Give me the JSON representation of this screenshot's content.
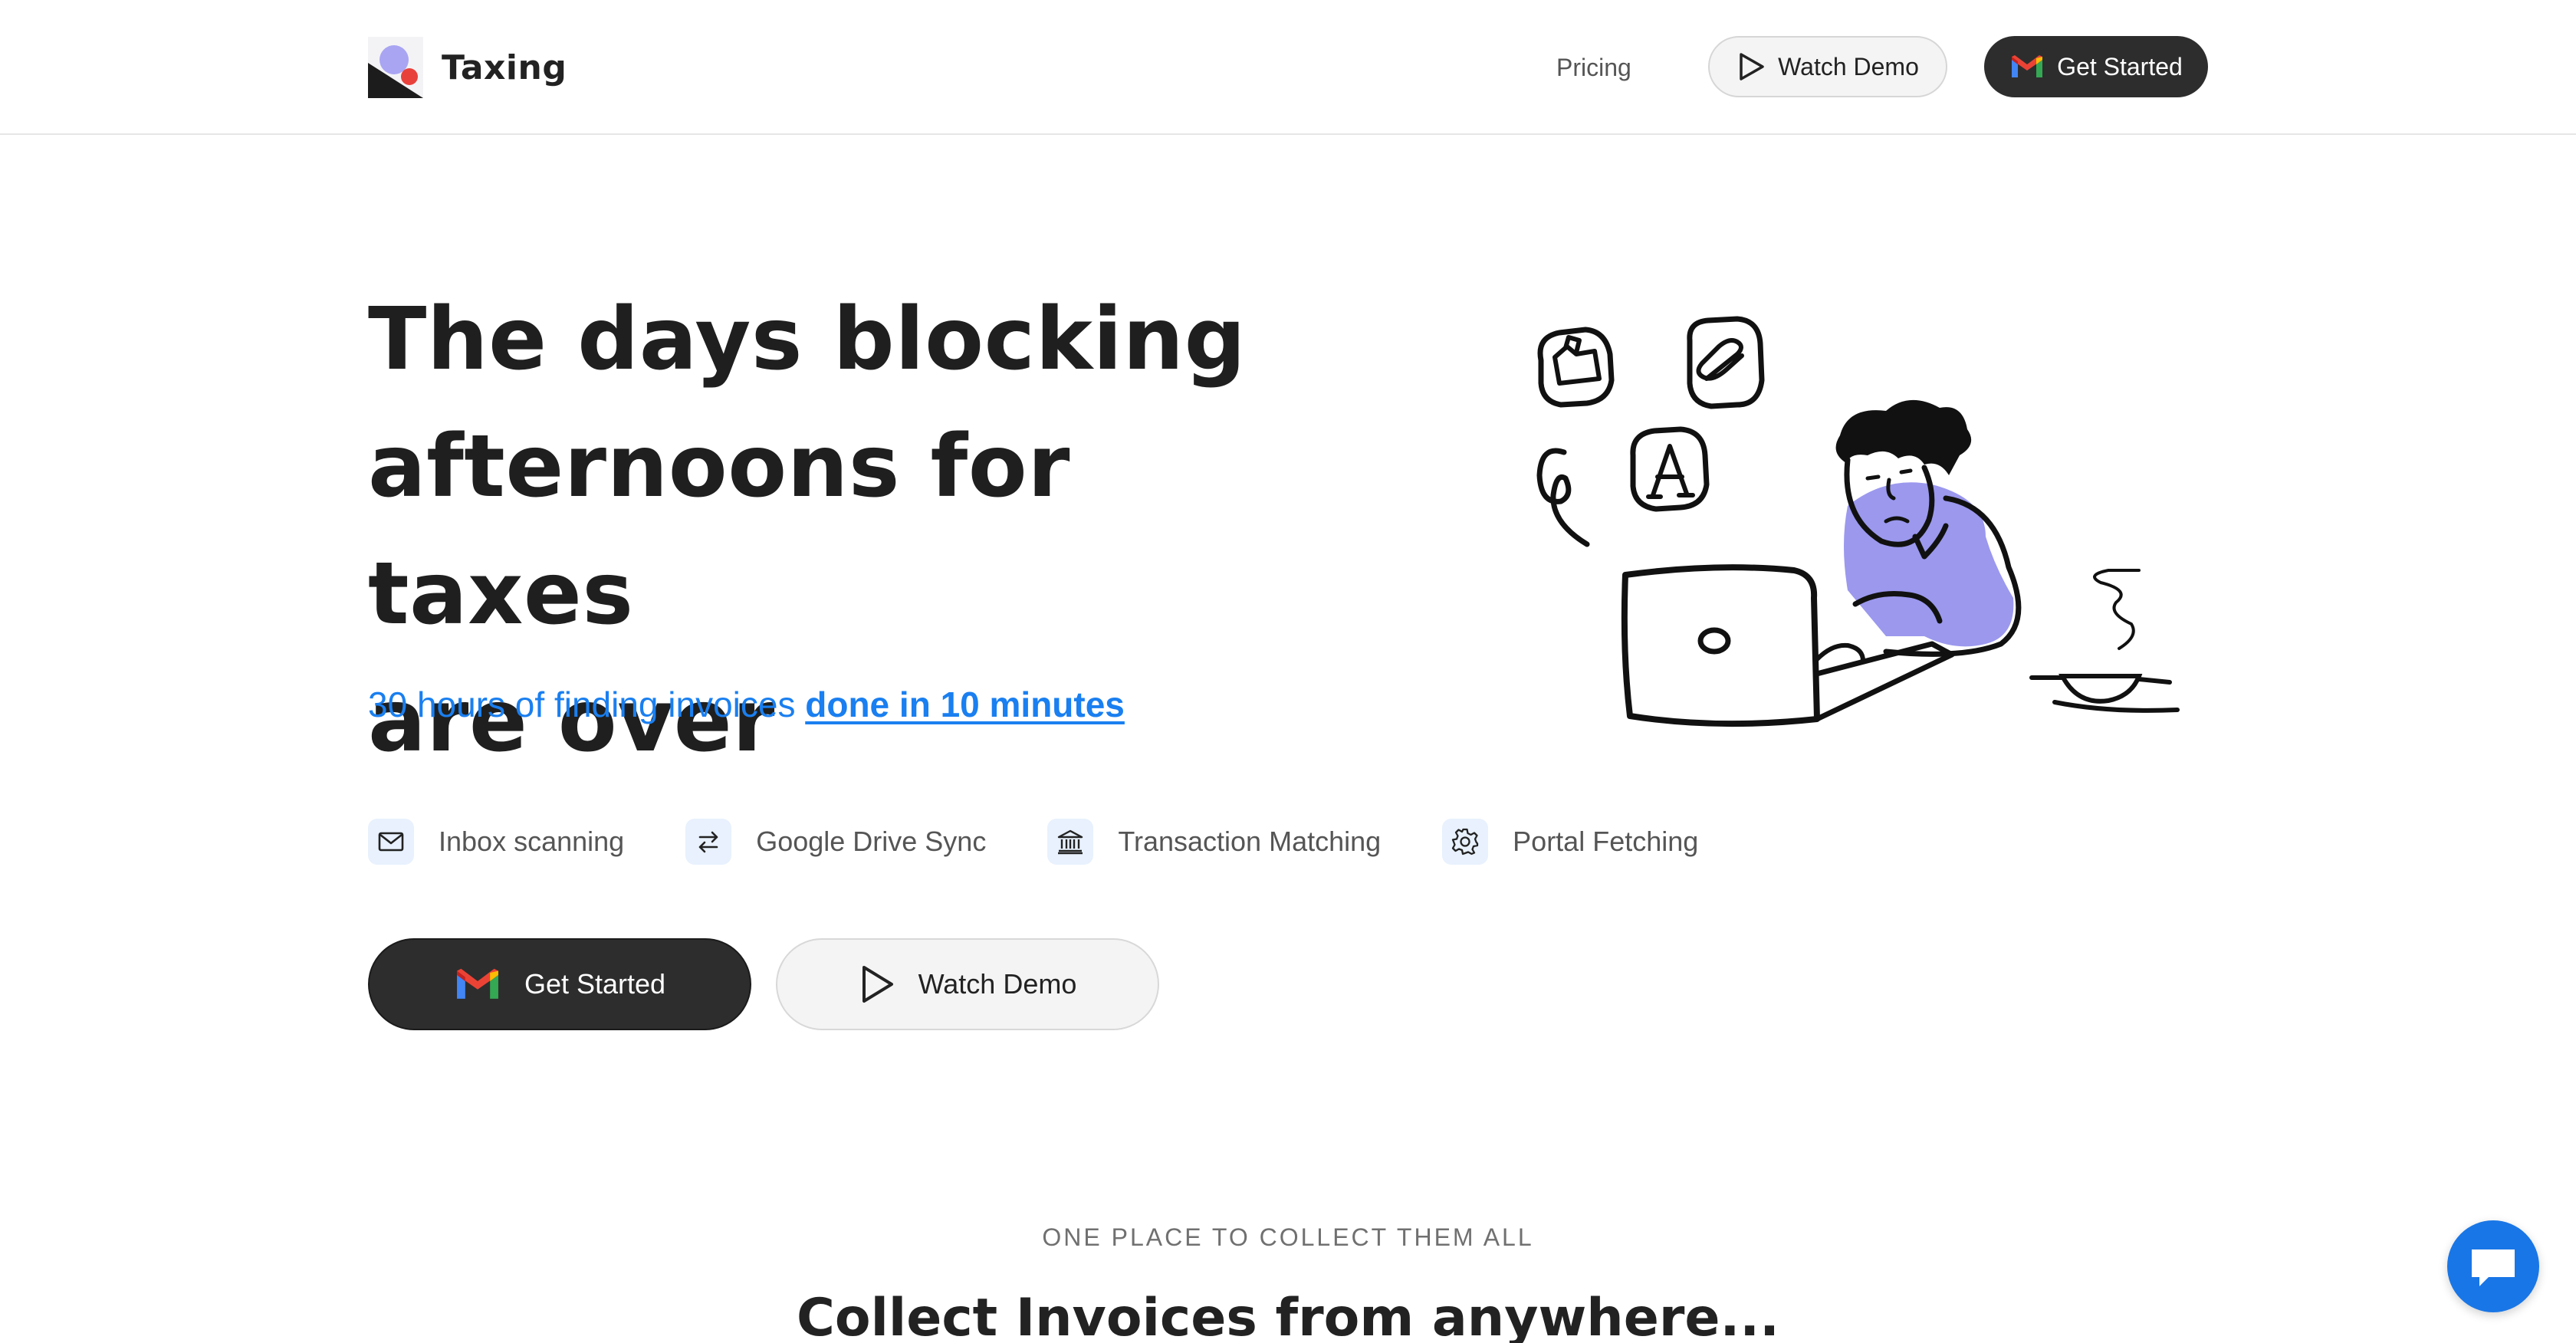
{
  "nav": {
    "brand": "Taxing",
    "pricing": "Pricing",
    "watch_demo": "Watch Demo",
    "get_started": "Get Started"
  },
  "hero": {
    "title_line1": "The days blocking",
    "title_line2": "afternoons for taxes",
    "title_line3": "are over",
    "subtitle_prefix": "30 hours of finding invoices",
    "subtitle_link": "done in 10 minutes",
    "features": [
      {
        "label": "Inbox scanning",
        "icon": "mail-icon"
      },
      {
        "label": "Google Drive Sync",
        "icon": "sync-arrows-icon"
      },
      {
        "label": "Transaction Matching",
        "icon": "bank-icon"
      },
      {
        "label": "Portal Fetching",
        "icon": "gear-icon"
      }
    ],
    "cta_primary": "Get Started",
    "cta_secondary": "Watch Demo"
  },
  "section": {
    "eyebrow": "ONE PLACE TO COLLECT THEM ALL",
    "title": "Collect Invoices from anywhere..."
  },
  "colors": {
    "accent_blue": "#1a7ff0",
    "dark_button": "#2d2d2d",
    "illustration_purple": "#9b98ee",
    "logo_red": "#e8413c",
    "chat_blue": "#1976e6"
  }
}
